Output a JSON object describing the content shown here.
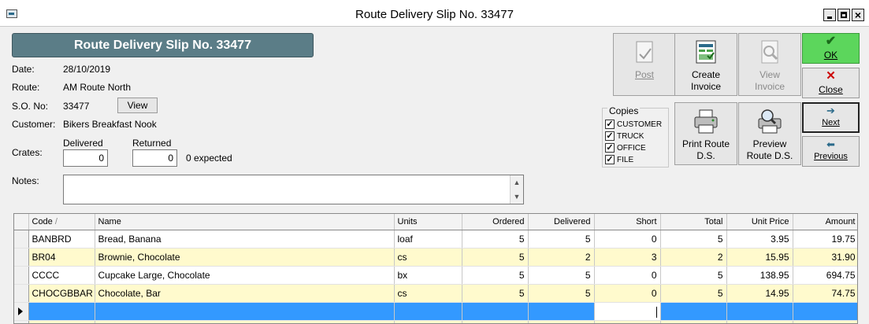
{
  "window": {
    "title": "Route Delivery Slip No. 33477"
  },
  "header": {
    "title": "Route Delivery Slip No. 33477"
  },
  "form": {
    "date_label": "Date:",
    "date": "28/10/2019",
    "route_label": "Route:",
    "route": "AM Route North",
    "so_label": "S.O. No:",
    "so": "33477",
    "view_label": "View",
    "customer_label": "Customer:",
    "customer": "Bikers Breakfast Nook",
    "crates_label": "Crates:",
    "delivered_label": "Delivered",
    "delivered": "0",
    "returned_label": "Returned",
    "returned": "0",
    "expected": "0 expected",
    "notes_label": "Notes:",
    "notes": ""
  },
  "toolbar": {
    "post": "Post",
    "create_invoice_1": "Create",
    "create_invoice_2": "Invoice",
    "view_invoice_1": "View",
    "view_invoice_2": "Invoice",
    "print_1": "Print Route",
    "print_2": "D.S.",
    "preview_1": "Preview",
    "preview_2": "Route D.S.",
    "ok": "OK",
    "close": "Close",
    "next": "Next",
    "previous": "Previous"
  },
  "copies": {
    "title": "Copies",
    "items": [
      {
        "label": "CUSTOMER",
        "checked": true
      },
      {
        "label": "TRUCK",
        "checked": true
      },
      {
        "label": "OFFICE",
        "checked": true
      },
      {
        "label": "FILE",
        "checked": true
      }
    ]
  },
  "grid": {
    "columns": [
      "Code",
      "Name",
      "Units",
      "Ordered",
      "Delivered",
      "Short",
      "Total",
      "Unit Price",
      "Amount"
    ],
    "sort_indicator": "/",
    "rows": [
      [
        "BANBRD",
        "Bread, Banana",
        "loaf",
        "5",
        "5",
        "0",
        "5",
        "3.95",
        "19.75"
      ],
      [
        "BR04",
        "Brownie, Chocolate",
        "cs",
        "5",
        "2",
        "3",
        "2",
        "15.95",
        "31.90"
      ],
      [
        "CCCC",
        "Cupcake Large, Chocolate",
        "bx",
        "5",
        "5",
        "0",
        "5",
        "138.95",
        "694.75"
      ],
      [
        "CHOCGBBAR",
        "Chocolate, Bar",
        "cs",
        "5",
        "5",
        "0",
        "5",
        "14.95",
        "74.75"
      ]
    ]
  },
  "colors": {
    "header_bg": "#5b7d87",
    "ok_bg": "#5cd65c",
    "alt_row": "#fffacd",
    "active_row": "#3399ff"
  }
}
